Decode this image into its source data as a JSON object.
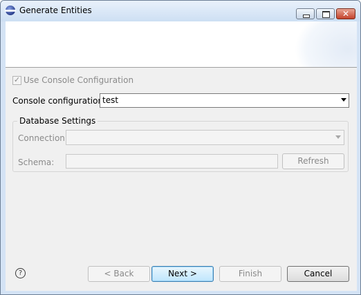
{
  "window": {
    "title": "Generate Entities",
    "icon": "eclipse-icon"
  },
  "main": {
    "use_console_label": "Use Console Configuration",
    "use_console_checked": true,
    "console_config_label": "Console configuration:",
    "console_config_value": "test",
    "db_group_title": "Database Settings",
    "connection_label": "Connection:",
    "connection_value": "",
    "schema_label": "Schema:",
    "schema_value": "",
    "refresh_label": "Refresh"
  },
  "footer": {
    "help_glyph": "?",
    "back_label": "< Back",
    "next_label": "Next >",
    "finish_label": "Finish",
    "cancel_label": "Cancel"
  },
  "colors": {
    "titlebar": "#cddff3",
    "close_button": "#c4432b",
    "dialog_background": "#f0f0f0",
    "disabled_text": "#8a8a8a",
    "default_button_border": "#3c7fb1"
  }
}
